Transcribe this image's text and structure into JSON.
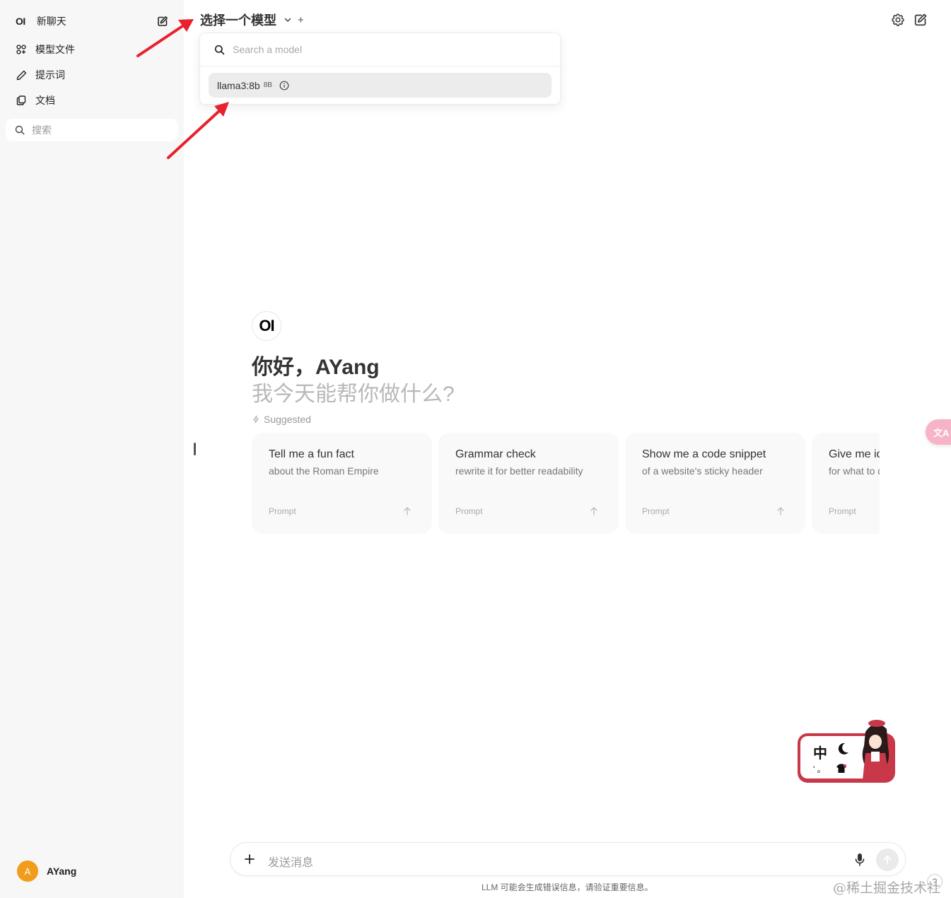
{
  "sidebar": {
    "logo": "OI",
    "new_chat": "新聊天",
    "items": [
      {
        "label": "模型文件",
        "icon": "grid-icon"
      },
      {
        "label": "提示词",
        "icon": "pencil-icon"
      },
      {
        "label": "文档",
        "icon": "documents-icon"
      }
    ],
    "search_placeholder": "搜索",
    "user": {
      "initial": "A",
      "name": "AYang"
    }
  },
  "header": {
    "model_title": "选择一个模型",
    "add_symbol": "+"
  },
  "model_dropdown": {
    "search_placeholder": "Search a model",
    "models": [
      {
        "name": "llama3:8b",
        "size": "8B"
      }
    ]
  },
  "main": {
    "logo": "OI",
    "greeting": "你好，AYang",
    "subgreeting": "我今天能帮你做什么?",
    "suggested_label": "Suggested",
    "cards": [
      {
        "title": "Tell me a fun fact",
        "subtitle": "about the Roman Empire",
        "tag": "Prompt"
      },
      {
        "title": "Grammar check",
        "subtitle": "rewrite it for better readability",
        "tag": "Prompt"
      },
      {
        "title": "Show me a code snippet",
        "subtitle": "of a website's sticky header",
        "tag": "Prompt"
      },
      {
        "title": "Give me ideas",
        "subtitle": "for what to do",
        "tag": "Prompt"
      }
    ]
  },
  "translate_tab": {
    "label": "文A"
  },
  "ime": {
    "char": "中",
    "dots": "' 。"
  },
  "input": {
    "placeholder": "发送消息",
    "disclaimer": "LLM 可能会生成错误信息，请验证重要信息。"
  },
  "help": "?",
  "watermark": "@稀土掘金技术社区",
  "colors": {
    "sidebar_bg": "#f7f7f7",
    "avatar": "#f29c1b",
    "arrow": "#e8212d",
    "ime_frame": "#c83848"
  }
}
